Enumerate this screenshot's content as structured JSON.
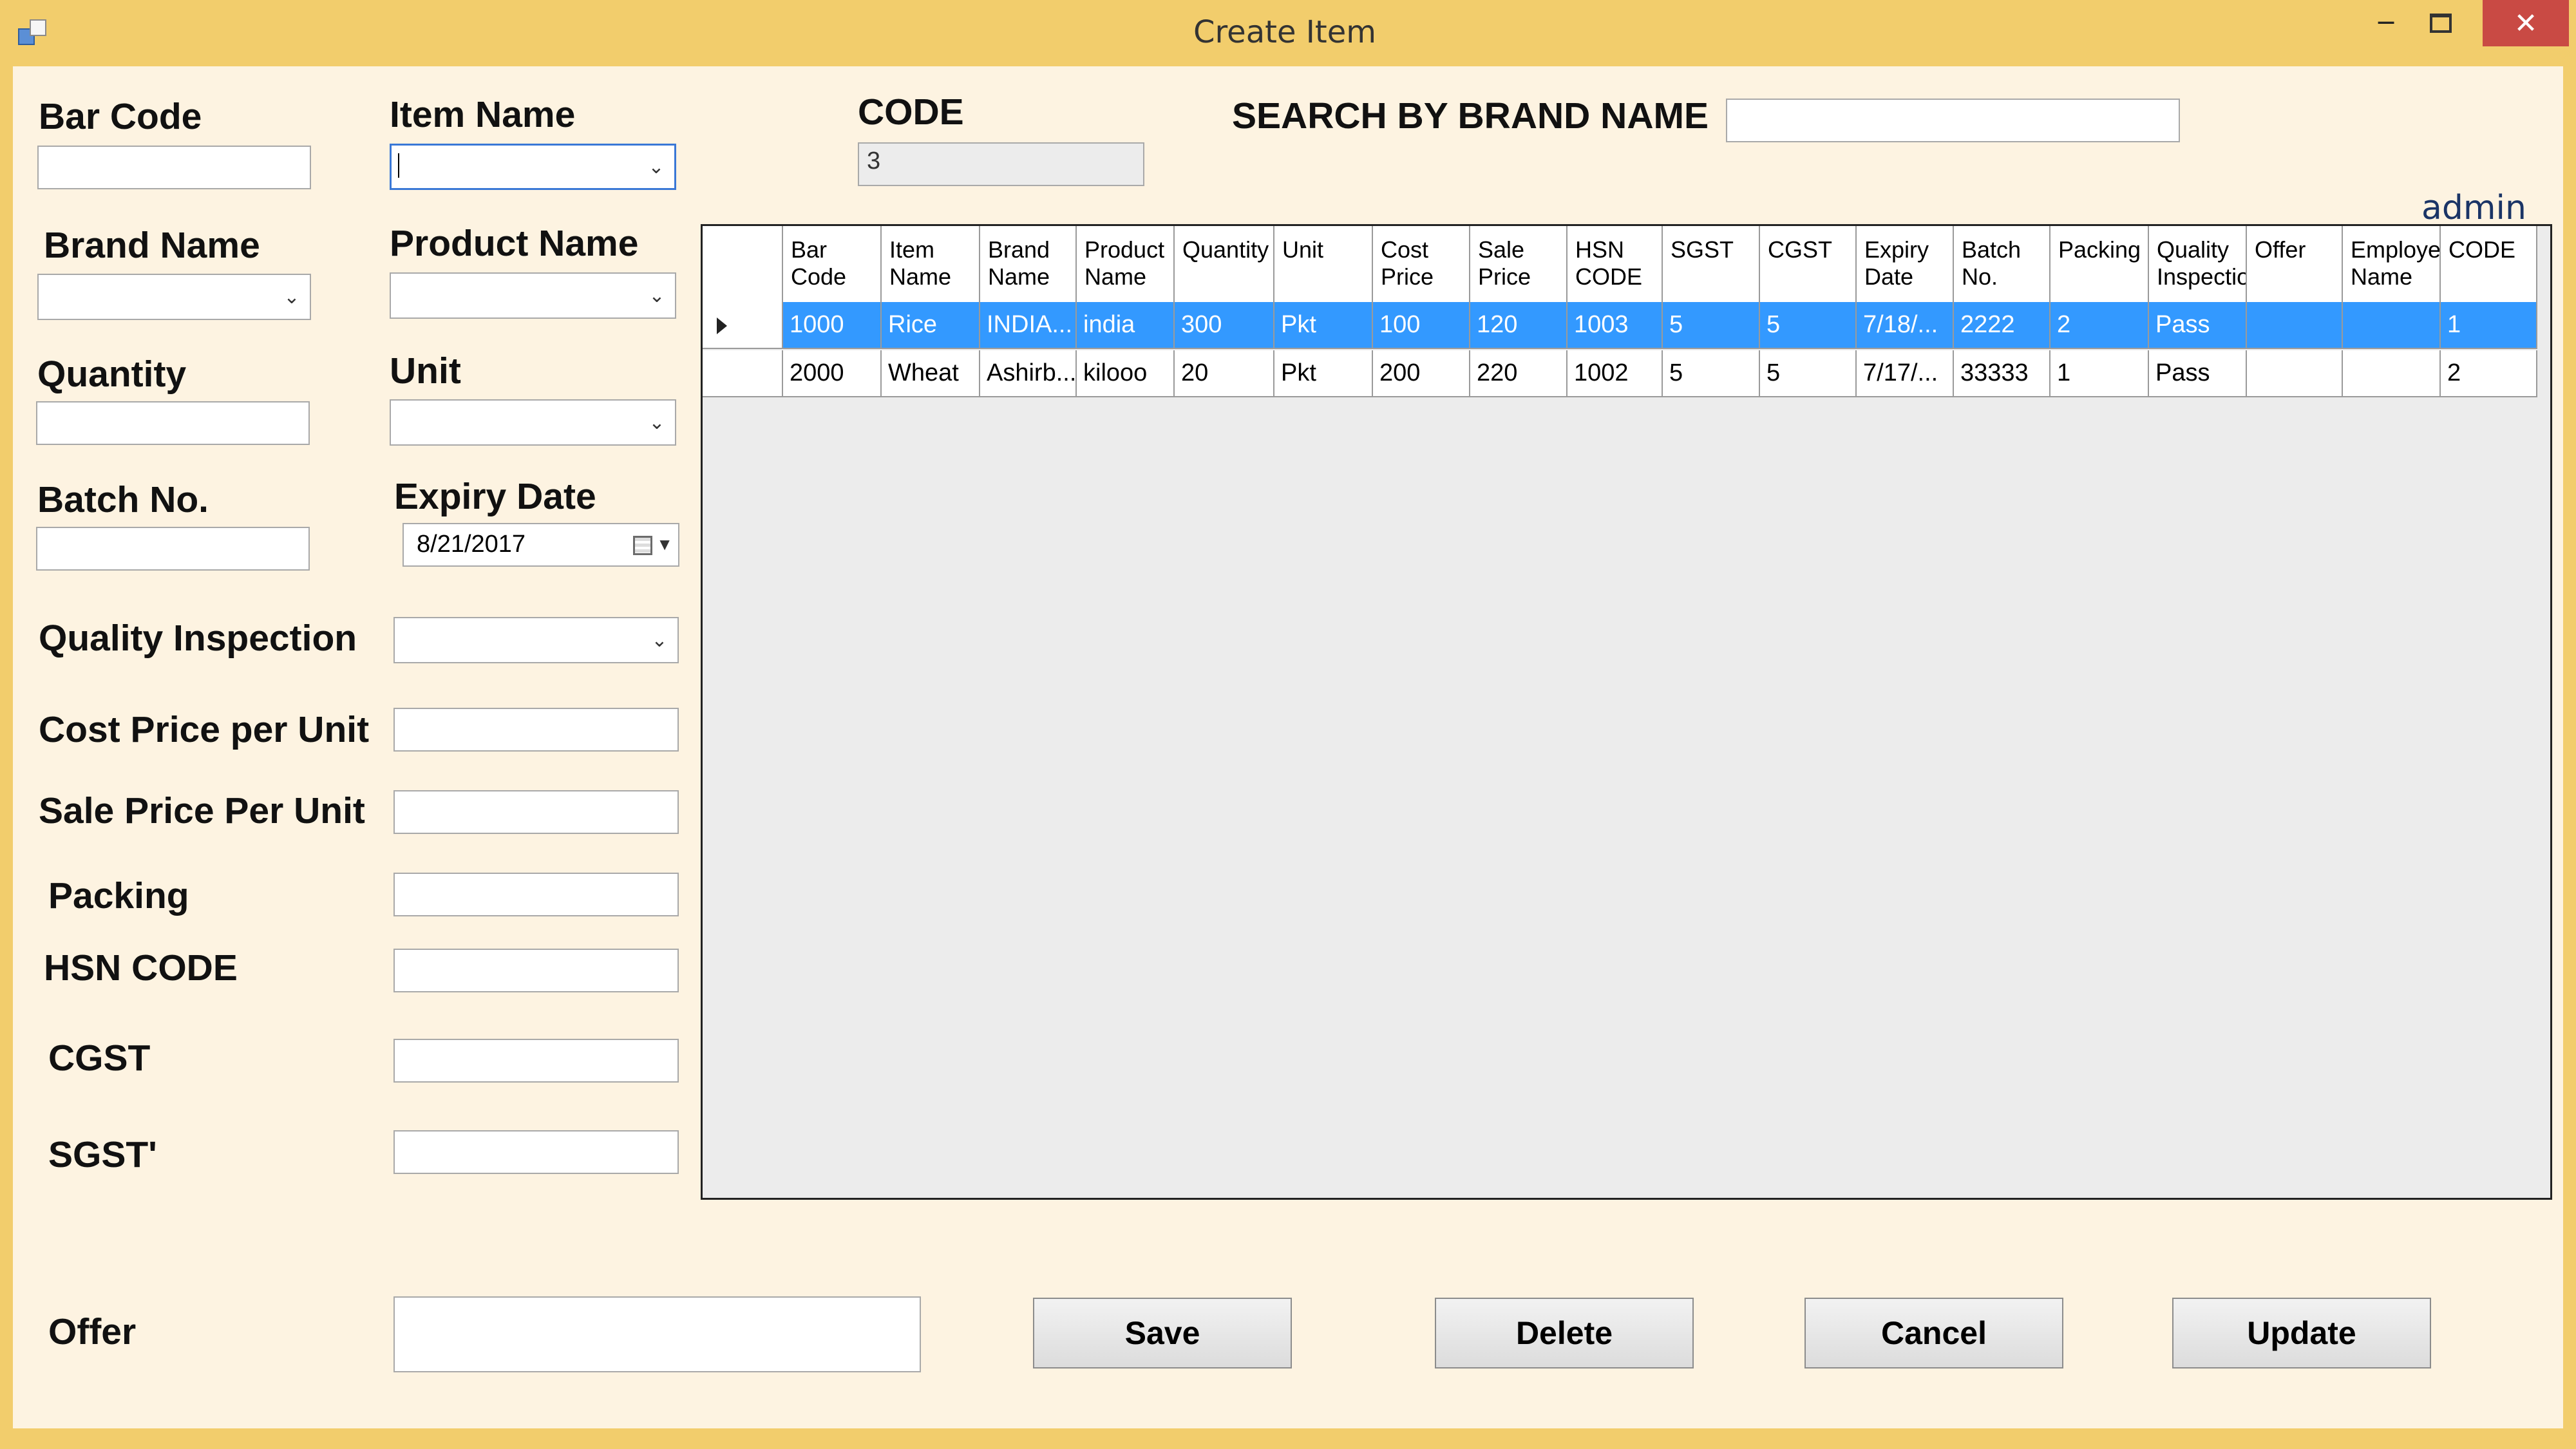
{
  "window": {
    "title": "Create Item",
    "user": "admin"
  },
  "form": {
    "bar_code_label": "Bar Code",
    "item_name_label": "Item Name",
    "code_label": "CODE",
    "code_value": "3",
    "search_label": "SEARCH BY BRAND NAME",
    "brand_name_label": "Brand Name",
    "product_name_label": "Product Name",
    "quantity_label": "Quantity",
    "unit_label": "Unit",
    "batch_no_label": "Batch No.",
    "expiry_date_label": "Expiry Date",
    "expiry_date_value": "8/21/2017",
    "quality_inspection_label": "Quality Inspection",
    "cost_price_label": "Cost Price per Unit",
    "sale_price_label": "Sale Price Per Unit",
    "packing_label": "Packing",
    "hsn_code_label": "HSN CODE",
    "cgst_label": "CGST",
    "sgst_label": "SGST'",
    "offer_label": "Offer"
  },
  "grid": {
    "columns": [
      "Bar\nCode",
      "Item\nName",
      "Brand\nName",
      "Product\nName",
      "Quantity",
      "Unit",
      "Cost\nPrice",
      "Sale\nPrice",
      "HSN\nCODE",
      "SGST",
      "CGST",
      "Expiry\nDate",
      "Batch\nNo.",
      "Packing",
      "Quality\nInspectio",
      "Offer",
      "Employe\nName",
      "CODE"
    ],
    "rows": [
      [
        "1000",
        "Rice",
        "INDIA...",
        "india",
        "300",
        "Pkt",
        "100",
        "120",
        "1003",
        "5",
        "5",
        "7/18/...",
        "2222",
        "2",
        "Pass",
        "",
        "",
        "1"
      ],
      [
        "2000",
        "Wheat",
        "Ashirb...",
        "kilooo",
        "20",
        "Pkt",
        "200",
        "220",
        "1002",
        "5",
        "5",
        "7/17/...",
        "33333",
        "1",
        "Pass",
        "",
        "",
        "2"
      ]
    ],
    "selected_row": 0
  },
  "buttons": {
    "save": "Save",
    "delete": "Delete",
    "cancel": "Cancel",
    "update": "Update"
  }
}
